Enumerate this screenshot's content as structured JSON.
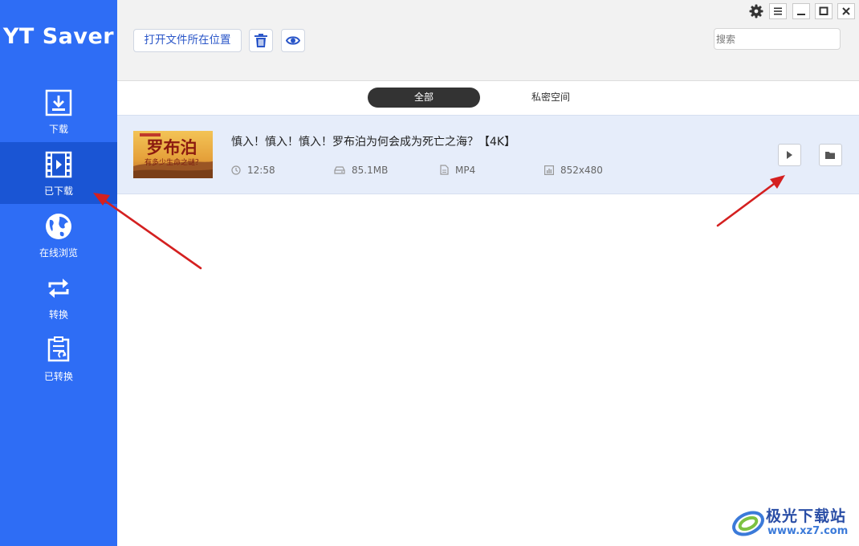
{
  "app": {
    "name": "YT Saver"
  },
  "sidebar": {
    "items": [
      {
        "label": "下载",
        "icon": "download-icon"
      },
      {
        "label": "已下载",
        "icon": "film-icon",
        "active": true
      },
      {
        "label": "在线浏览",
        "icon": "globe-icon"
      },
      {
        "label": "转换",
        "icon": "convert-icon"
      },
      {
        "label": "已转换",
        "icon": "converted-doc-icon"
      }
    ]
  },
  "toolbar": {
    "open_location_label": "打开文件所在位置",
    "delete_icon": "trash-icon",
    "preview_icon": "eye-icon",
    "search_placeholder": "搜索"
  },
  "window_controls": [
    "gear-icon",
    "menu-icon",
    "minimize-icon",
    "maximize-icon",
    "close-icon"
  ],
  "tabs": [
    {
      "label": "全部",
      "active": true
    },
    {
      "label": "私密空间",
      "active": false
    }
  ],
  "videos": [
    {
      "title": "慎入！慎入！慎入！罗布泊为何会成为死亡之海？【4K】",
      "thumbnail_text": "罗布泊",
      "thumbnail_subtext": "有多少生命之谜？",
      "duration": "12:58",
      "size": "85.1MB",
      "format": "MP4",
      "resolution": "852x480"
    }
  ],
  "watermark": {
    "title": "极光下载站",
    "url": "www.xz7.com"
  },
  "colors": {
    "sidebar": "#2e6df5",
    "sidebar_active": "#1a55d4",
    "accent_text": "#2a56c8",
    "arrow": "#d42020",
    "row_bg": "#e6edfa"
  }
}
